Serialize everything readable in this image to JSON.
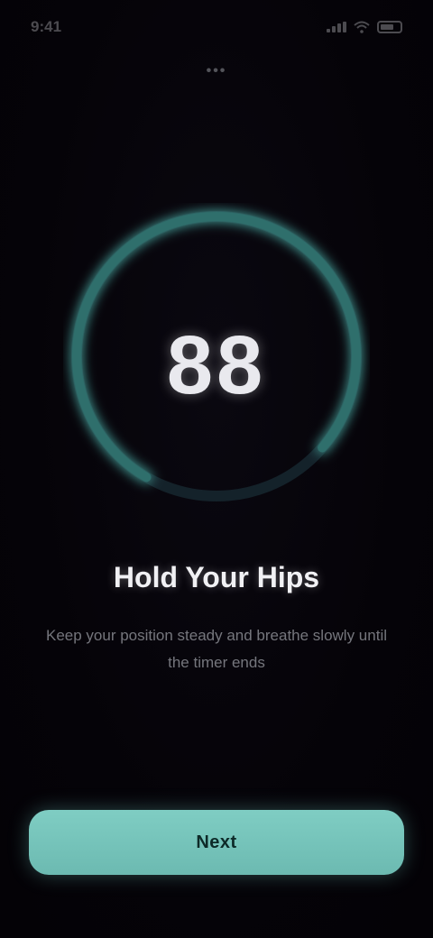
{
  "status_bar": {
    "time": "9:41",
    "icons": [
      "signal-icon",
      "wifi-icon",
      "battery-icon"
    ]
  },
  "header": {
    "label": "•••"
  },
  "timer": {
    "value": "88",
    "progress": 0.78,
    "ring_color": "#3f8f8a",
    "track_color": "#1a2a2c"
  },
  "content": {
    "title": "Hold Your Hips",
    "subtitle": "Keep your position steady and breathe slowly until the timer ends"
  },
  "primary_button": {
    "label": "Next",
    "color": "#7fcdc3"
  }
}
